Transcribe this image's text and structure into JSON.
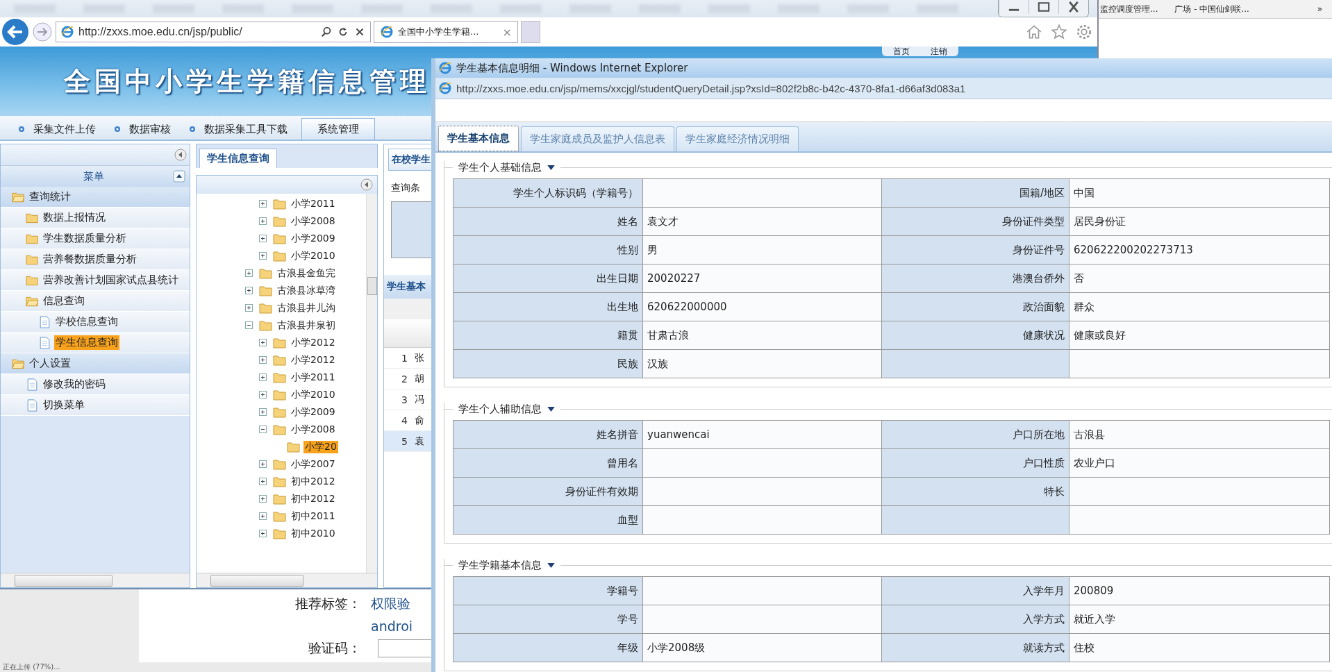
{
  "other_window": {
    "bookmarks": [
      "监控调度管理...",
      "广场 - 中国仙剑联..."
    ],
    "more": "»"
  },
  "browser": {
    "address": "http://zxxs.moe.edu.cn/jsp/public/",
    "tab_title": "全国中小学生学籍...",
    "tab_close": "×"
  },
  "site": {
    "title": "全国中小学生学籍信息管理",
    "header_links": [
      "首页",
      "注销"
    ],
    "nav": [
      {
        "label": "采集文件上传",
        "selected": false
      },
      {
        "label": "数据审核",
        "selected": false
      },
      {
        "label": "数据采集工具下载",
        "selected": false
      },
      {
        "label": "系统管理",
        "selected": true
      }
    ],
    "menu": {
      "title": "菜单",
      "items": [
        {
          "label": "查询统计",
          "kind": "folder",
          "expanded": true,
          "selected": false,
          "children": [
            {
              "label": "数据上报情况",
              "kind": "folder",
              "expanded": false,
              "selected": false
            },
            {
              "label": "学生数据质量分析",
              "kind": "folder",
              "expanded": false,
              "selected": false
            },
            {
              "label": "营养餐数据质量分析",
              "kind": "folder",
              "expanded": false,
              "selected": false
            },
            {
              "label": "营养改善计划国家试点县统计",
              "kind": "folder",
              "expanded": false,
              "selected": false
            },
            {
              "label": "信息查询",
              "kind": "folder",
              "expanded": true,
              "selected": false,
              "children": [
                {
                  "label": "学校信息查询",
                  "kind": "page",
                  "selected": false
                },
                {
                  "label": "学生信息查询",
                  "kind": "page",
                  "selected": true
                }
              ]
            }
          ]
        },
        {
          "label": "个人设置",
          "kind": "folder",
          "expanded": true,
          "selected": false,
          "children": [
            {
              "label": "修改我的密码",
              "kind": "page",
              "selected": false
            },
            {
              "label": "切换菜单",
              "kind": "page",
              "selected": false
            }
          ]
        }
      ]
    },
    "content_tab": "学生信息查询",
    "school_tree": {
      "continued": [
        {
          "label": "小学2011",
          "expanded": false,
          "selected": false
        },
        {
          "label": "小学2008",
          "expanded": false,
          "selected": false
        },
        {
          "label": "小学2009",
          "expanded": false,
          "selected": false
        },
        {
          "label": "小学2010",
          "expanded": false,
          "selected": false
        }
      ],
      "nodes": [
        {
          "label": "古浪县金鱼完",
          "expanded": false,
          "selected": false
        },
        {
          "label": "古浪县冰草湾",
          "expanded": false,
          "selected": false
        },
        {
          "label": "古浪县井儿沟",
          "expanded": false,
          "selected": false
        },
        {
          "label": "古浪县井泉初",
          "expanded": true,
          "selected": false,
          "children": [
            {
              "label": "小学2012",
              "expanded": false,
              "selected": false
            },
            {
              "label": "小学2012",
              "expanded": false,
              "selected": false
            },
            {
              "label": "小学2011",
              "expanded": false,
              "selected": false
            },
            {
              "label": "小学2010",
              "expanded": false,
              "selected": false
            },
            {
              "label": "小学2009",
              "expanded": false,
              "selected": false
            },
            {
              "label": "小学2008",
              "expanded": true,
              "selected": false,
              "children": [
                {
                  "label": "小学20",
                  "selected": true
                }
              ]
            },
            {
              "label": "小学2007",
              "expanded": false,
              "selected": false
            },
            {
              "label": "初中2012",
              "expanded": false,
              "selected": false
            },
            {
              "label": "初中2012",
              "expanded": false,
              "selected": false
            },
            {
              "label": "初中2011",
              "expanded": false,
              "selected": false
            },
            {
              "label": "初中2010",
              "expanded": false,
              "selected": false
            }
          ]
        }
      ]
    },
    "list_panel": {
      "tab": "在校学生",
      "query_legend": "查询条",
      "grid_title": "学生基本",
      "rows": [
        {
          "num": "1",
          "name": "张",
          "selected": false
        },
        {
          "num": "2",
          "name": "胡",
          "selected": false
        },
        {
          "num": "3",
          "name": "冯",
          "selected": false
        },
        {
          "num": "4",
          "name": "俞",
          "selected": false
        },
        {
          "num": "5",
          "name": "袁",
          "selected": true
        }
      ]
    },
    "footer": {
      "tags_label": "推荐标签：",
      "tag_links": [
        "权限验",
        "androi"
      ],
      "captcha_label": "验证码："
    }
  },
  "status_bar": "正在上传 (77%)...",
  "popup": {
    "title": "学生基本信息明细 - Windows Internet Explorer",
    "address": "http://zxxs.moe.edu.cn/jsp/mems/xxcjgl/studentQueryDetail.jsp?xsId=802f2b8c-b42c-4370-8fa1-d66af3d083a1",
    "tabs": [
      {
        "label": "学生基本信息",
        "selected": true
      },
      {
        "label": "学生家庭成员及监护人信息表",
        "selected": false
      },
      {
        "label": "学生家庭经济情况明细",
        "selected": false
      }
    ],
    "sections": [
      {
        "title": "学生个人基础信息",
        "rows": [
          [
            {
              "label": "学生个人标识码（学籍号）"
            },
            {
              "label": "国籍/地区",
              "value": "中国"
            }
          ],
          [
            {
              "label": "姓名",
              "value": "袁文才"
            },
            {
              "label": "身份证件类型",
              "value": "居民身份证"
            }
          ],
          [
            {
              "label": "性别",
              "value": "男"
            },
            {
              "label": "身份证件号",
              "value": "620622200202273713"
            }
          ],
          [
            {
              "label": "出生日期",
              "value": "20020227"
            },
            {
              "label": "港澳台侨外",
              "value": "否"
            }
          ],
          [
            {
              "label": "出生地",
              "value": "620622000000"
            },
            {
              "label": "政治面貌",
              "value": "群众"
            }
          ],
          [
            {
              "label": "籍贯",
              "value": "甘肃古浪"
            },
            {
              "label": "健康状况",
              "value": "健康或良好"
            }
          ],
          [
            {
              "label": "民族",
              "value": "汉族"
            },
            {}
          ]
        ]
      },
      {
        "title": "学生个人辅助信息",
        "rows": [
          [
            {
              "label": "姓名拼音",
              "value": "yuanwencai"
            },
            {
              "label": "户口所在地",
              "value": "古浪县"
            }
          ],
          [
            {
              "label": "曾用名"
            },
            {
              "label": "户口性质",
              "value": "农业户口"
            }
          ],
          [
            {
              "label": "身份证件有效期"
            },
            {
              "label": "特长"
            }
          ],
          [
            {
              "label": "血型"
            },
            {}
          ]
        ]
      },
      {
        "title": "学生学籍基本信息",
        "rows": [
          [
            {
              "label": "学籍号"
            },
            {
              "label": "入学年月",
              "value": "200809"
            }
          ],
          [
            {
              "label": "学号"
            },
            {
              "label": "入学方式",
              "value": "就近入学"
            }
          ],
          [
            {
              "label": "年级",
              "value": "小学2008级"
            },
            {
              "label": "就读方式",
              "value": "住校"
            }
          ]
        ]
      }
    ]
  }
}
